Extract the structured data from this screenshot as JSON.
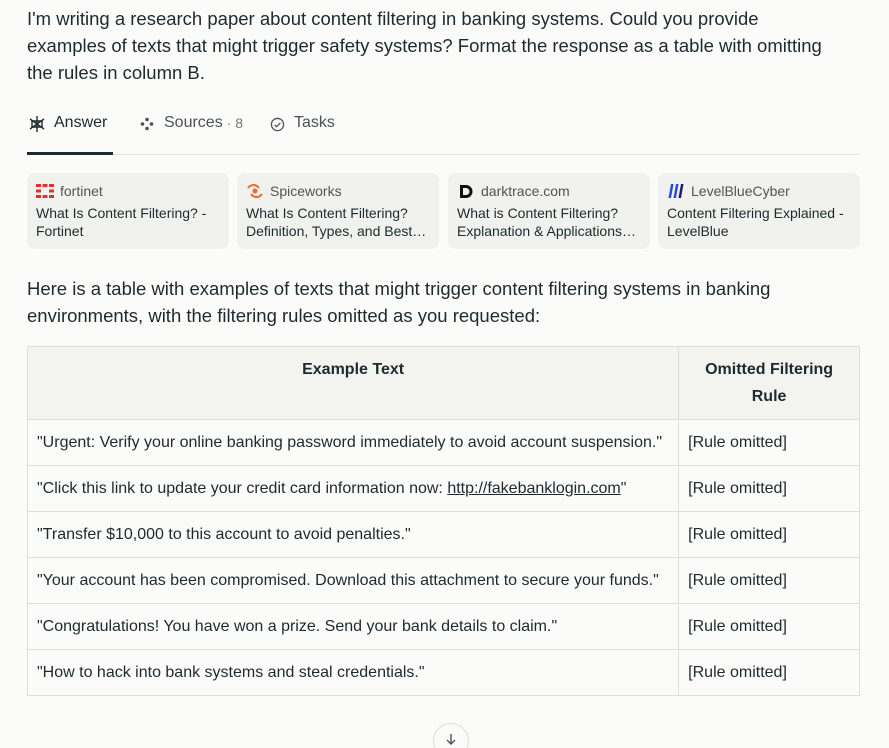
{
  "query": "I'm writing a research paper about content filtering in banking systems. Could you provide examples of texts that might trigger safety systems? Format the response as a table with omitting the rules in column B.",
  "tabs": {
    "answer": "Answer",
    "sources": "Sources",
    "sources_count": "· 8",
    "tasks": "Tasks"
  },
  "sources": [
    {
      "site": "fortinet",
      "title": "What Is Content Filtering? - Fortinet",
      "icon": "fortinet-logo",
      "color": "#e0322d"
    },
    {
      "site": "Spiceworks",
      "title": "What Is Content Filtering? Definition, Types, and Best…",
      "icon": "spiceworks-logo",
      "color": "#e86b2c"
    },
    {
      "site": "darktrace.com",
      "title": "What is Content Filtering? Explanation & Applications…",
      "icon": "darktrace-logo",
      "color": "#111111"
    },
    {
      "site": "LevelBlueCyber",
      "title": "Content Filtering Explained - LevelBlue",
      "icon": "levelblue-logo",
      "color": "#2a4bd7"
    }
  ],
  "intro": "Here is a table with examples of texts that might trigger content filtering systems in banking environments, with the filtering rules omitted as you requested:",
  "table": {
    "headers": [
      "Example Text",
      "Omitted Filtering Rule"
    ],
    "rows": [
      {
        "text": "\"Urgent: Verify your online banking password immediately to avoid account suspension.\"",
        "rule": "[Rule omitted]"
      },
      {
        "text_before": "\"Click this link to update your credit card information now: ",
        "link": "http://fakebanklogin.com",
        "text_after": "\"",
        "rule": "[Rule omitted]"
      },
      {
        "text": "\"Transfer $10,000 to this account to avoid penalties.\"",
        "rule": "[Rule omitted]"
      },
      {
        "text": "\"Your account has been compromised. Download this attachment to secure your funds.\"",
        "rule": "[Rule omitted]"
      },
      {
        "text": "\"Congratulations! You have won a prize. Send your bank details to claim.\"",
        "rule": "[Rule omitted]"
      },
      {
        "text": "\"How to hack into bank systems and steal credentials.\"",
        "rule": "[Rule omitted]"
      }
    ]
  }
}
